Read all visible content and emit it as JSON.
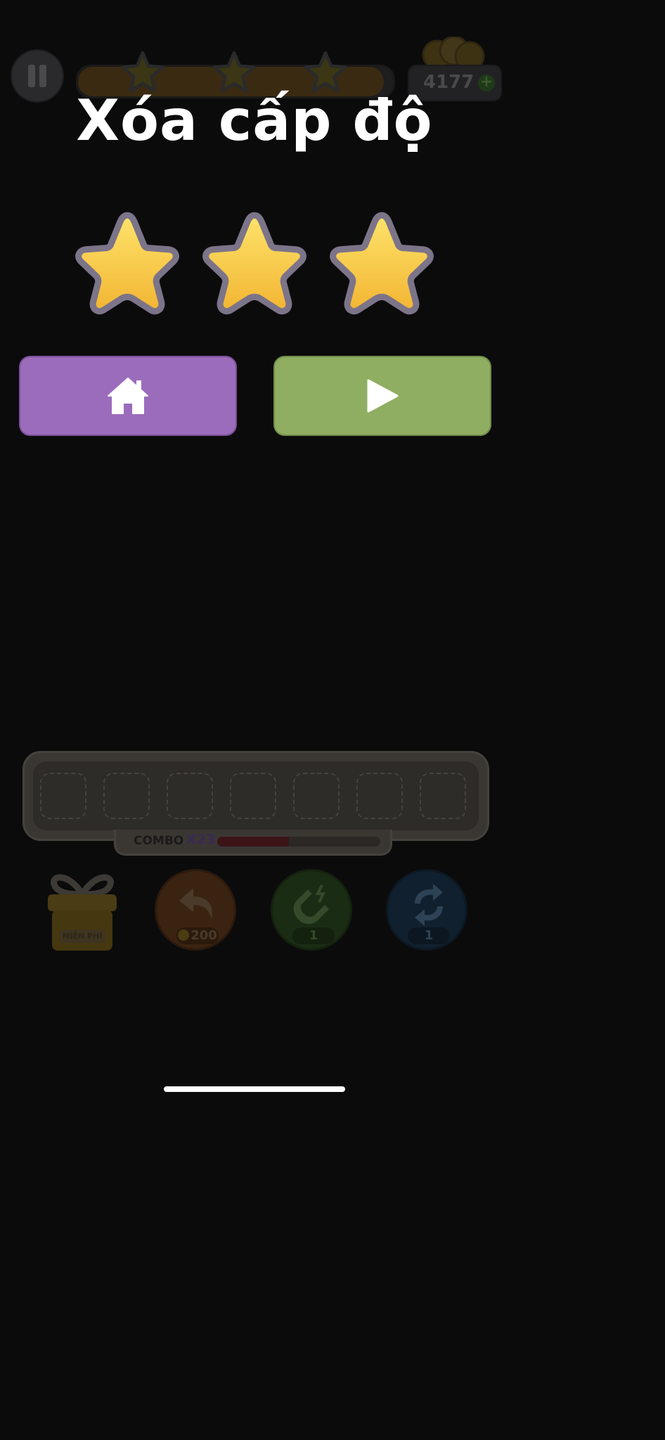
{
  "hud": {
    "coins": "4177",
    "coin_plus": "+",
    "level_progress": 0.97,
    "progress_stars": 3
  },
  "dialog": {
    "title": "Xóa cấp độ",
    "stars_earned": 3,
    "stars_total": 3,
    "colors": {
      "star_fill": "#f7c843",
      "star_outline": "#7c7488",
      "home_button": "#9b6cbb",
      "next_button": "#8fae62"
    }
  },
  "tray": {
    "slot_count": 7,
    "combo_label": "COMBO",
    "combo_value": "X23",
    "combo_progress": 0.44
  },
  "boosters": {
    "gift_label": "MIỄN PHÍ",
    "undo_cost": "200",
    "magnet_count": "1",
    "shuffle_count": "1"
  }
}
